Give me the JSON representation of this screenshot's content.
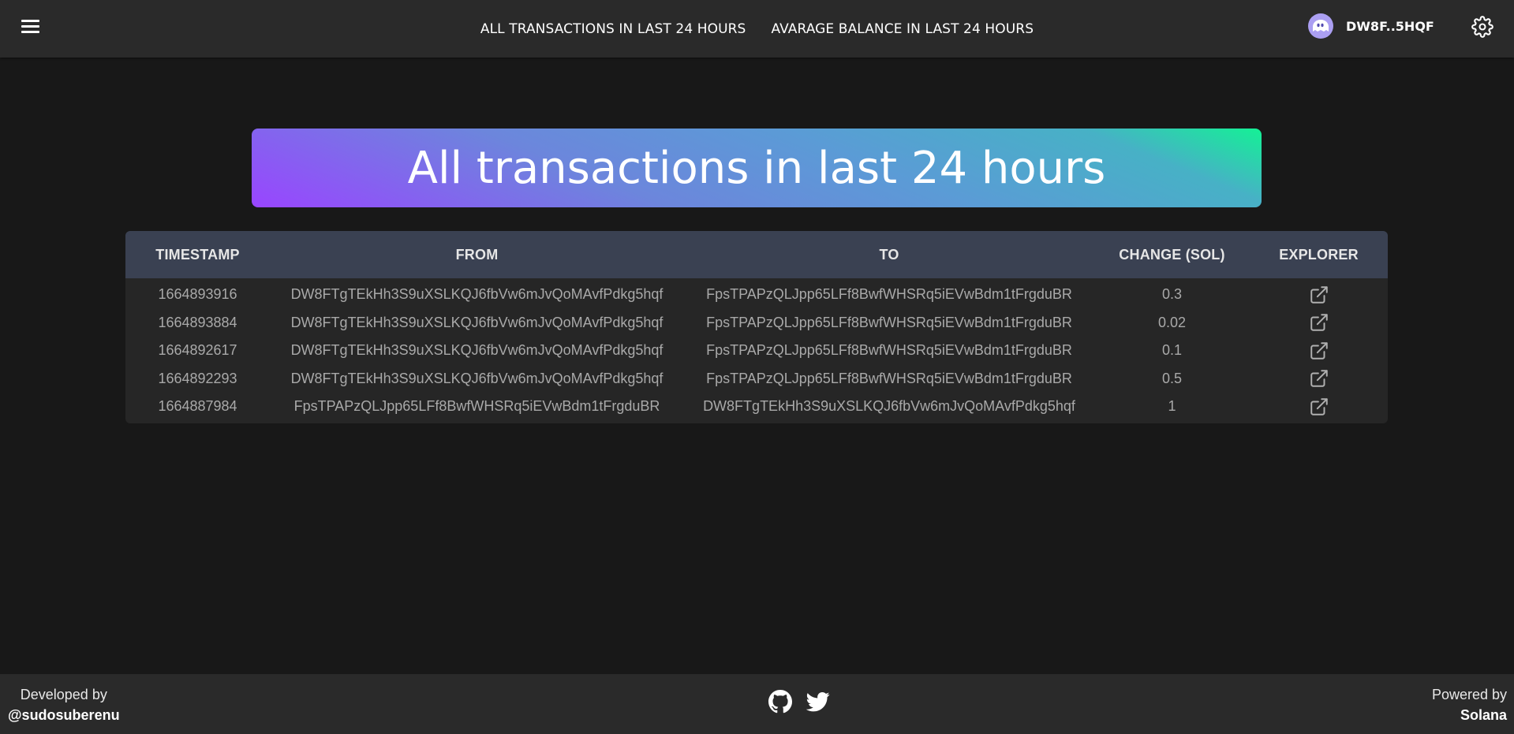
{
  "header": {
    "nav": [
      {
        "label": "ALL TRANSACTIONS IN LAST 24 HOURS"
      },
      {
        "label": "AVARAGE BALANCE IN LAST 24 HOURS"
      }
    ],
    "wallet_address": "DW8F..5HQF",
    "icons": {
      "menu": "hamburger-menu-icon",
      "wallet": "phantom-ghost-icon",
      "settings": "gear-icon"
    }
  },
  "banner": {
    "title": "All transactions in last 24 hours"
  },
  "table": {
    "columns": [
      "TIMESTAMP",
      "FROM",
      "TO",
      "CHANGE (SOL)",
      "EXPLORER"
    ],
    "rows": [
      {
        "timestamp": "1664893916",
        "from": "DW8FTgTEkHh3S9uXSLKQJ6fbVw6mJvQoMAvfPdkg5hqf",
        "to": "FpsTPAPzQLJpp65LFf8BwfWHSRq5iEVwBdm1tFrgduBR",
        "change": "0.3"
      },
      {
        "timestamp": "1664893884",
        "from": "DW8FTgTEkHh3S9uXSLKQJ6fbVw6mJvQoMAvfPdkg5hqf",
        "to": "FpsTPAPzQLJpp65LFf8BwfWHSRq5iEVwBdm1tFrgduBR",
        "change": "0.02"
      },
      {
        "timestamp": "1664892617",
        "from": "DW8FTgTEkHh3S9uXSLKQJ6fbVw6mJvQoMAvfPdkg5hqf",
        "to": "FpsTPAPzQLJpp65LFf8BwfWHSRq5iEVwBdm1tFrgduBR",
        "change": "0.1"
      },
      {
        "timestamp": "1664892293",
        "from": "DW8FTgTEkHh3S9uXSLKQJ6fbVw6mJvQoMAvfPdkg5hqf",
        "to": "FpsTPAPzQLJpp65LFf8BwfWHSRq5iEVwBdm1tFrgduBR",
        "change": "0.5"
      },
      {
        "timestamp": "1664887984",
        "from": "FpsTPAPzQLJpp65LFf8BwfWHSRq5iEVwBdm1tFrgduBR",
        "to": "DW8FTgTEkHh3S9uXSLKQJ6fbVw6mJvQoMAvfPdkg5hqf",
        "change": "1"
      }
    ],
    "explorer_icon": "external-link-icon"
  },
  "footer": {
    "developed_label": "Developed by",
    "developer_handle": "@sudosuberenu",
    "powered_label": "Powered by",
    "powered_brand": "Solana",
    "social_icons": [
      "github-icon",
      "twitter-icon"
    ]
  },
  "colors": {
    "page_bg": "#181818",
    "bar_bg": "#2a2a2a",
    "table_header_bg": "#3a4152",
    "table_body_bg": "#262626",
    "gradient_start": "#9945ff",
    "gradient_end": "#14f195"
  }
}
